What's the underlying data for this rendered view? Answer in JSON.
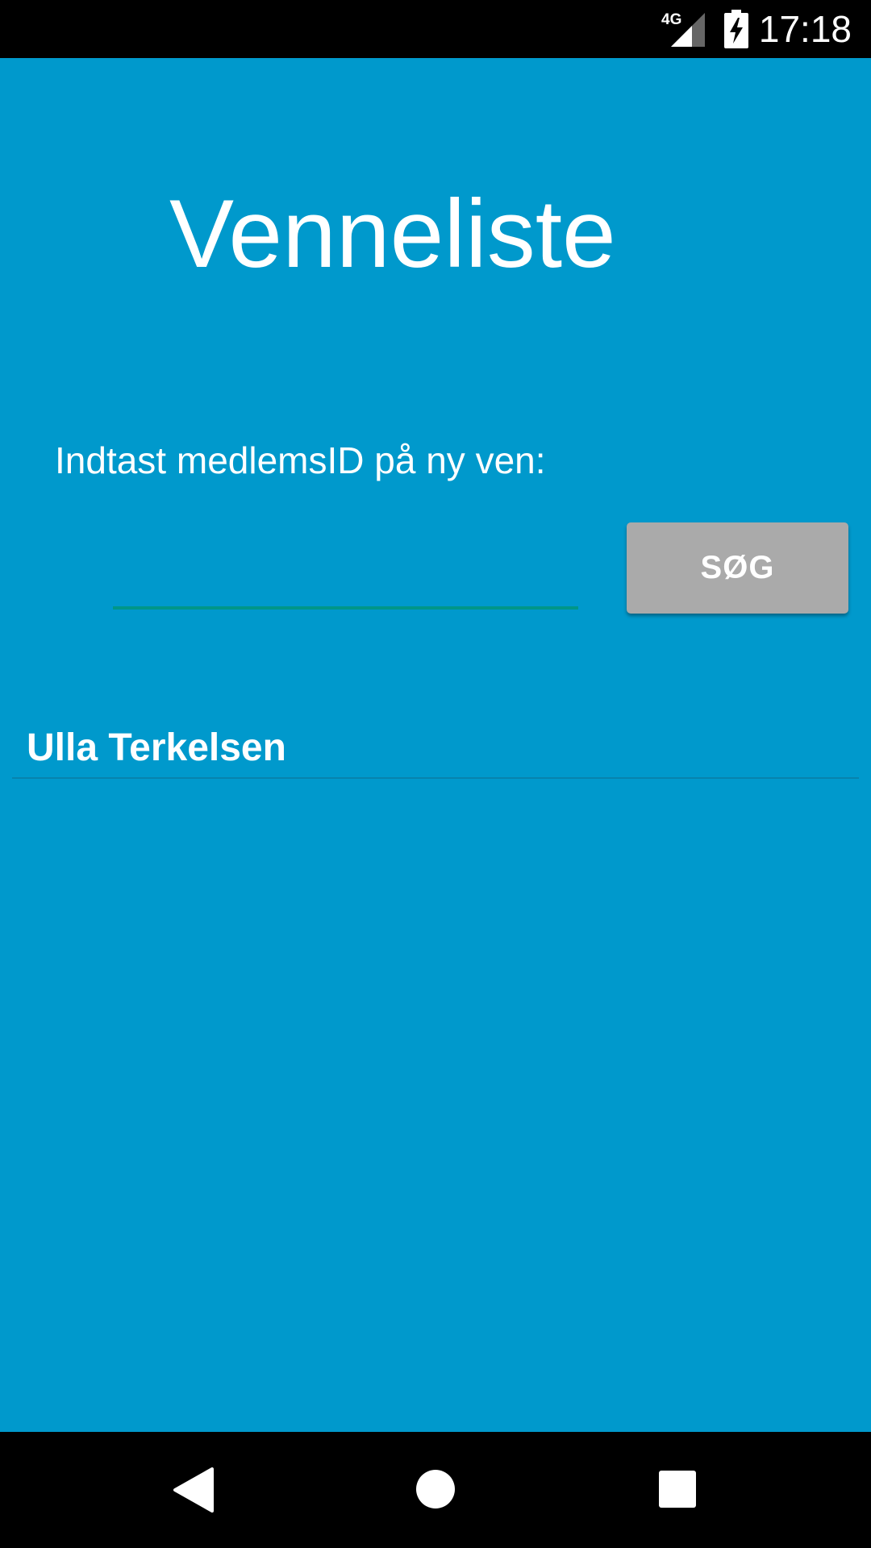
{
  "statusbar": {
    "network": "4G",
    "time": "17:18",
    "icons": [
      "signal-icon",
      "battery-charging-icon"
    ]
  },
  "main": {
    "title": "Venneliste",
    "prompt": "Indtast medlemsID på ny ven:",
    "input_value": "",
    "search_button": "SØG",
    "friends": [
      {
        "name": "Ulla Terkelsen"
      }
    ]
  },
  "colors": {
    "background": "#0099cc",
    "button": "#aaaaaa",
    "input_underline": "#009688",
    "text": "#ffffff"
  },
  "navbar": {
    "icons": [
      "back-icon",
      "home-icon",
      "recents-icon"
    ]
  }
}
